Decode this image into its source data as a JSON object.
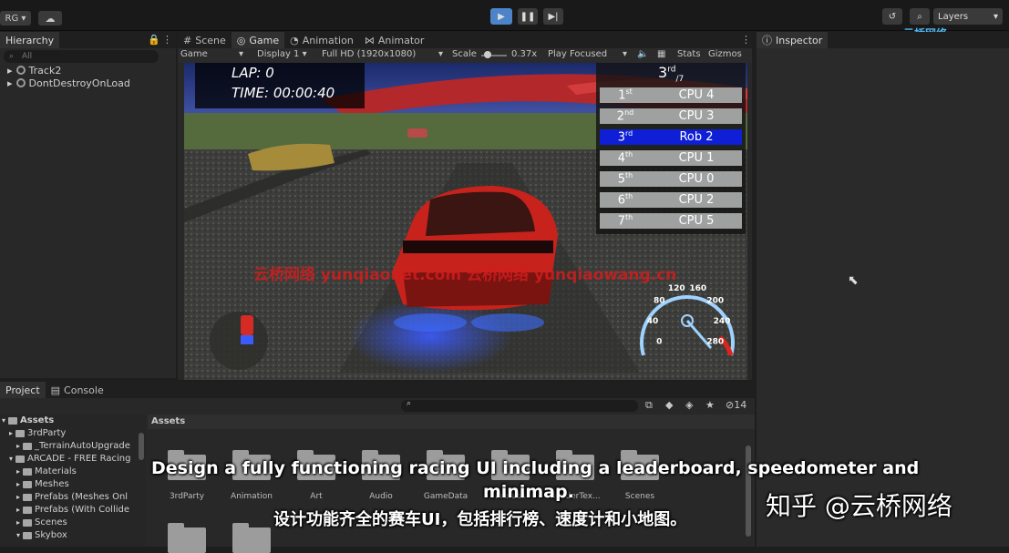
{
  "toolbar": {
    "account": "RG",
    "layers": "Layers",
    "layers_caret": "▾"
  },
  "hierarchy": {
    "title": "Hierarchy",
    "search_placeholder": "All",
    "items": [
      "Track2",
      "DontDestroyOnLoad"
    ]
  },
  "view_tabs": [
    "Scene",
    "Game",
    "Animation",
    "Animator"
  ],
  "game_toolbar": {
    "mode": "Game",
    "display": "Display 1",
    "resolution": "Full HD (1920x1080)",
    "scale_label": "Scale",
    "scale_value": "0.37x",
    "play_mode": "Play Focused",
    "stats": "Stats",
    "gizmos": "Gizmos"
  },
  "inspector": {
    "title": "Inspector"
  },
  "watermark_logo": "云桥网络",
  "hud": {
    "lap": "LAP: 0",
    "time": "TIME: 00:00:40",
    "position_num": "3",
    "position_suffix": "rd",
    "position_total": "/7"
  },
  "leaderboard": [
    {
      "pos": "1",
      "sfx": "st",
      "name": "CPU 4",
      "player": false
    },
    {
      "pos": "2",
      "sfx": "nd",
      "name": "CPU 3",
      "player": false
    },
    {
      "pos": "3",
      "sfx": "rd",
      "name": "Rob 2",
      "player": true
    },
    {
      "pos": "4",
      "sfx": "th",
      "name": "CPU 1",
      "player": false
    },
    {
      "pos": "5",
      "sfx": "th",
      "name": "CPU 0",
      "player": false
    },
    {
      "pos": "6",
      "sfx": "th",
      "name": "CPU 2",
      "player": false
    },
    {
      "pos": "7",
      "sfx": "th",
      "name": "CPU 5",
      "player": false
    }
  ],
  "speedometer": {
    "ticks": [
      "0",
      "40",
      "80",
      "120",
      "160",
      "200",
      "240",
      "280"
    ],
    "needle_speed": 0
  },
  "overlay_watermark": "云桥网络 yunqiaonet.com 云桥网络 yunqiaowang.cn",
  "project": {
    "tabs": [
      "Project",
      "Console"
    ],
    "tree": [
      "Assets",
      "3rdParty",
      "_TerrainAutoUpgrade",
      "ARCADE - FREE Racing",
      "Materials",
      "Meshes",
      "Prefabs (Meshes Onl",
      "Prefabs (With Collide",
      "Scenes",
      "Skybox"
    ],
    "breadcrumb": "Assets",
    "hidden_count": "14",
    "folders": [
      "3rdParty",
      "Animation",
      "Art",
      "Audio",
      "GameData",
      "Prefabs",
      "RenderTex...",
      "Scenes"
    ]
  },
  "subtitles": {
    "en_line1": "Design a fully functioning racing UI including a leaderboard, speedometer and",
    "en_line2": "minimap.",
    "zh": "设计功能齐全的赛车UI，包括排行榜、速度计和小地图。"
  },
  "zhihu_watermark": "知乎 @云桥网络",
  "colors": {
    "accent": "#4d84c9",
    "player_row": "#0f1fd6",
    "rank_row": "#9fa0a0",
    "watermark_red": "#d11d1d",
    "car_red": "#c8221d"
  }
}
